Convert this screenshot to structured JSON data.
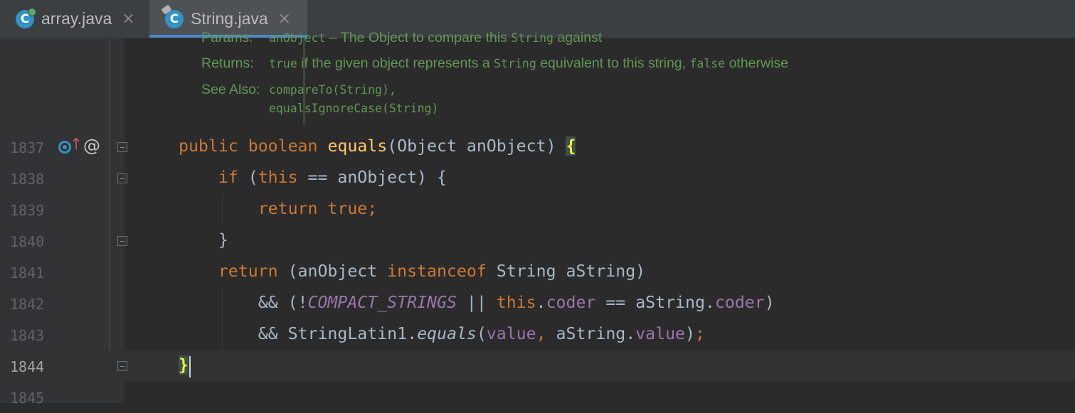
{
  "tabs": [
    {
      "label": "array.java",
      "close": "×",
      "icon": "java-class-icon"
    },
    {
      "label": "String.java",
      "close": "×",
      "icon": "java-class-icon"
    }
  ],
  "doc": {
    "params_label": "Params:",
    "params_name": "anObject",
    "params_text": " – The Object to compare this ",
    "params_code": "String",
    "params_tail": " against",
    "returns_label": "Returns:",
    "returns_code1": "true",
    "returns_text1": " if the given object represents a ",
    "returns_code2": "String",
    "returns_text2": " equivalent to this string, ",
    "returns_code3": "false",
    "returns_text3": " otherwise",
    "see_label": "See Also:",
    "see_link1": "compareTo(String)",
    "see_sep": ",",
    "see_link2": "equalsIgnoreCase(String)"
  },
  "lines": [
    {
      "n": "1837"
    },
    {
      "n": "1838"
    },
    {
      "n": "1839"
    },
    {
      "n": "1840"
    },
    {
      "n": "1841"
    },
    {
      "n": "1842"
    },
    {
      "n": "1843"
    },
    {
      "n": "1844"
    },
    {
      "n": "1845"
    }
  ],
  "code": {
    "l1837": {
      "kw1": "public",
      "kw2": "boolean",
      "fn": "equals",
      "rest": "(Object anObject) ",
      "brace": "{"
    },
    "l1838": {
      "kw": "if",
      "rest": " (",
      "kw2": "this",
      "rest2": " == anObject) {"
    },
    "l1839": {
      "kw": "return true;"
    },
    "l1840": {
      "text": "}"
    },
    "l1841": {
      "kw": "return",
      "t1": " (anObject ",
      "kw2": "instanceof",
      "t2": " String aString)"
    },
    "l1842": {
      "t1": "&& (!",
      "cst": "COMPACT_STRINGS",
      "t2": " || ",
      "kw": "this",
      "t3": ".",
      "fld": "coder",
      "t4": " == aString.",
      "fld2": "coder",
      "t5": ")"
    },
    "l1843": {
      "t1": "&& StringLatin1.",
      "it": "equals",
      "t2": "(",
      "fld": "value",
      "kw": ",",
      "t3": " aString.",
      "fld2": "value",
      "t4": ")",
      "kw2": ";"
    },
    "l1844": {
      "brace": "}"
    }
  },
  "colors": {
    "keyword": "#cc7832",
    "function": "#ffc66d",
    "field": "#9876aa",
    "doc": "#629755",
    "link": "#5694d6",
    "text": "#a9b7c6"
  }
}
